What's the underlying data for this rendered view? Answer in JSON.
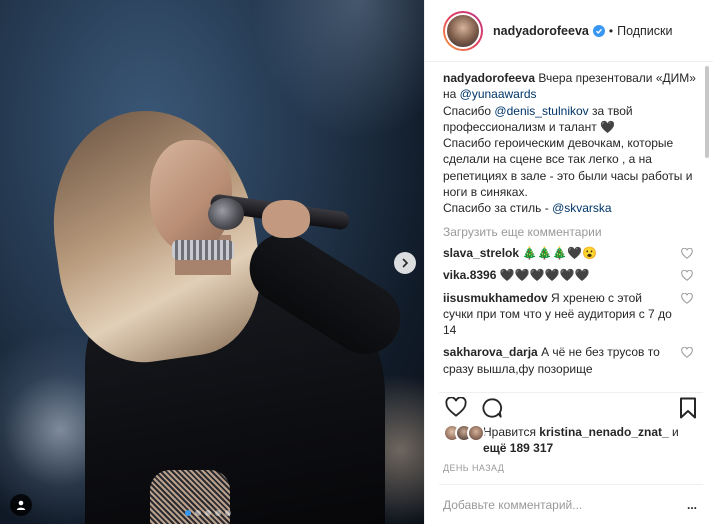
{
  "post": {
    "username": "nadyadorofeeva",
    "separator": "•",
    "follow_label": "Подписки",
    "caption_parts": [
      "Вчера презентовали «ДИМ» на ",
      "@yunaawards",
      "Спасибо ",
      "@denis_stulnikov",
      " за твой профессионализм и талант 🖤",
      "Спасибо героическим девочкам, которые сделали на сцене все так легко , а на репетициях в зале - это были часы работы и ноги в синяках.",
      "Спасибо за стиль - ",
      "@skvarska"
    ],
    "load_more_label": "Загрузить еще комментарии",
    "comments": [
      {
        "user": "slava_strelok",
        "text": "🎄🎄🎄🖤😮"
      },
      {
        "user": "vika.8396",
        "text": "🖤🖤🖤🖤🖤🖤"
      },
      {
        "user": "iisusmukhamedov",
        "text": "Я хренею с этой сучки при том что у неё аудитория с 7 до 14"
      },
      {
        "user": "sakharova_darja",
        "text": "А чё не без трусов то сразу вышла,фу позорище"
      }
    ],
    "likes_prefix": "Нравится",
    "likes_user": "kristina_nenado_znat_",
    "likes_and": "и",
    "likes_more": "ещё 189 317",
    "time_label": "ДЕНЬ НАЗАД",
    "add_comment_placeholder": "Добавьте комментарий...",
    "ellipsis_label": "..."
  },
  "colors": {
    "accent": "#3897f0",
    "mention": "#003569",
    "muted": "#999999",
    "text": "#262626",
    "border": "#efefef"
  },
  "icons": {
    "heart": "heart-icon",
    "comment": "comment-icon",
    "bookmark": "bookmark-icon",
    "next": "chevron-right-icon",
    "user_tag": "user-tag-icon",
    "verified": "verified-badge-icon"
  }
}
